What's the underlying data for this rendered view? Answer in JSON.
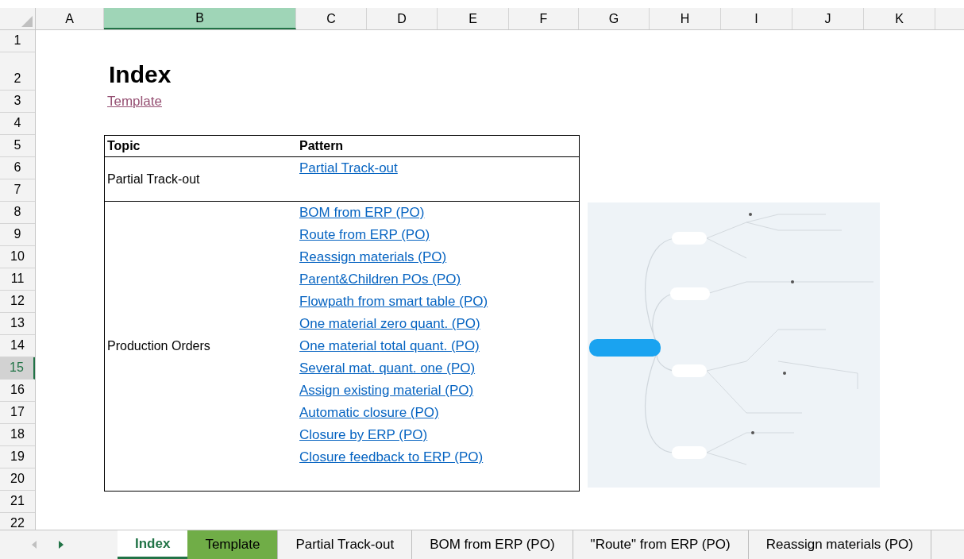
{
  "columns": [
    {
      "label": "A",
      "selected": false
    },
    {
      "label": "B",
      "selected": true
    },
    {
      "label": "C",
      "selected": false
    },
    {
      "label": "D",
      "selected": false
    },
    {
      "label": "E",
      "selected": false
    },
    {
      "label": "F",
      "selected": false
    },
    {
      "label": "G",
      "selected": false
    },
    {
      "label": "H",
      "selected": false
    },
    {
      "label": "I",
      "selected": false
    },
    {
      "label": "J",
      "selected": false
    },
    {
      "label": "K",
      "selected": false
    }
  ],
  "rows": [
    {
      "label": "1",
      "selected": false
    },
    {
      "label": "2",
      "selected": false
    },
    {
      "label": "3",
      "selected": false
    },
    {
      "label": "4",
      "selected": false
    },
    {
      "label": "5",
      "selected": false
    },
    {
      "label": "6",
      "selected": false
    },
    {
      "label": "7",
      "selected": false
    },
    {
      "label": "8",
      "selected": false
    },
    {
      "label": "9",
      "selected": false
    },
    {
      "label": "10",
      "selected": false
    },
    {
      "label": "11",
      "selected": false
    },
    {
      "label": "12",
      "selected": false
    },
    {
      "label": "13",
      "selected": false
    },
    {
      "label": "14",
      "selected": false
    },
    {
      "label": "15",
      "selected": true
    },
    {
      "label": "16",
      "selected": false
    },
    {
      "label": "17",
      "selected": false
    },
    {
      "label": "18",
      "selected": false
    },
    {
      "label": "19",
      "selected": false
    },
    {
      "label": "20",
      "selected": false
    },
    {
      "label": "21",
      "selected": false
    },
    {
      "label": "22",
      "selected": false
    }
  ],
  "title": "Index",
  "template_link": "Template",
  "table": {
    "columns": [
      "Topic",
      "Pattern"
    ],
    "groups": [
      {
        "topic": "Partial Track-out",
        "links": [
          "Partial Track-out"
        ]
      },
      {
        "topic": "Production Orders",
        "links": [
          "BOM from ERP (PO)",
          "Route from ERP (PO)",
          "Reassign materials (PO)",
          "Parent&Children POs (PO)",
          "Flowpath from smart table (PO)",
          "One material zero quant. (PO)",
          "One material total quant. (PO)",
          "Several mat. quant. one (PO)",
          "Assign existing material (PO)",
          "Automatic closure (PO)",
          "Closure by ERP (PO)",
          "Closure feedback to ERP (PO)"
        ]
      }
    ]
  },
  "nav": [
    {
      "kind": "prev",
      "disabled": true
    },
    {
      "kind": "next",
      "disabled": false
    }
  ],
  "sheet_tabs": [
    {
      "label": "Index",
      "selected": true
    },
    {
      "label": "Template",
      "selected": false,
      "color": "#70ad47"
    },
    {
      "label": "Partial Track-out",
      "selected": false
    },
    {
      "label": "BOM from ERP (PO)",
      "selected": false
    },
    {
      "label": "\"Route\" from ERP (PO)",
      "selected": false
    },
    {
      "label": "Reassign materials (PO)",
      "selected": false
    }
  ]
}
